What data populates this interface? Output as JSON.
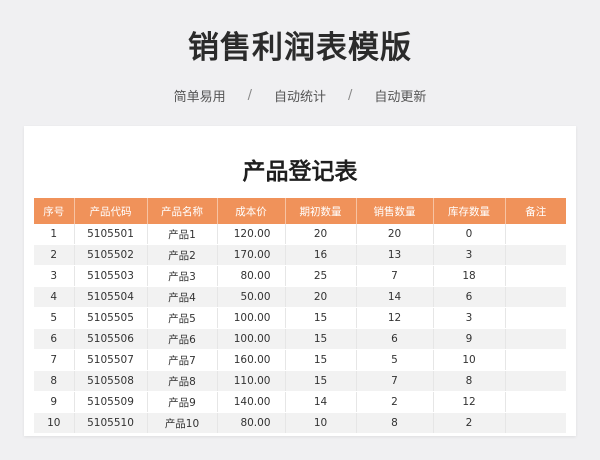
{
  "page": {
    "title": "销售利润表模版",
    "features": [
      "简单易用",
      "自动统计",
      "自动更新"
    ],
    "separator": "/"
  },
  "table": {
    "title": "产品登记表",
    "columns": [
      "序号",
      "产品代码",
      "产品名称",
      "成本价",
      "期初数量",
      "销售数量",
      "库存数量",
      "备注"
    ],
    "rows": [
      [
        "1",
        "5105501",
        "产品1",
        "120.00",
        "20",
        "20",
        "0",
        ""
      ],
      [
        "2",
        "5105502",
        "产品2",
        "170.00",
        "16",
        "13",
        "3",
        ""
      ],
      [
        "3",
        "5105503",
        "产品3",
        "80.00",
        "25",
        "7",
        "18",
        ""
      ],
      [
        "4",
        "5105504",
        "产品4",
        "50.00",
        "20",
        "14",
        "6",
        ""
      ],
      [
        "5",
        "5105505",
        "产品5",
        "100.00",
        "15",
        "12",
        "3",
        ""
      ],
      [
        "6",
        "5105506",
        "产品6",
        "100.00",
        "15",
        "6",
        "9",
        ""
      ],
      [
        "7",
        "5105507",
        "产品7",
        "160.00",
        "15",
        "5",
        "10",
        ""
      ],
      [
        "8",
        "5105508",
        "产品8",
        "110.00",
        "15",
        "7",
        "8",
        ""
      ],
      [
        "9",
        "5105509",
        "产品9",
        "140.00",
        "14",
        "2",
        "12",
        ""
      ],
      [
        "10",
        "5105510",
        "产品10",
        "80.00",
        "10",
        "8",
        "2",
        ""
      ]
    ]
  }
}
